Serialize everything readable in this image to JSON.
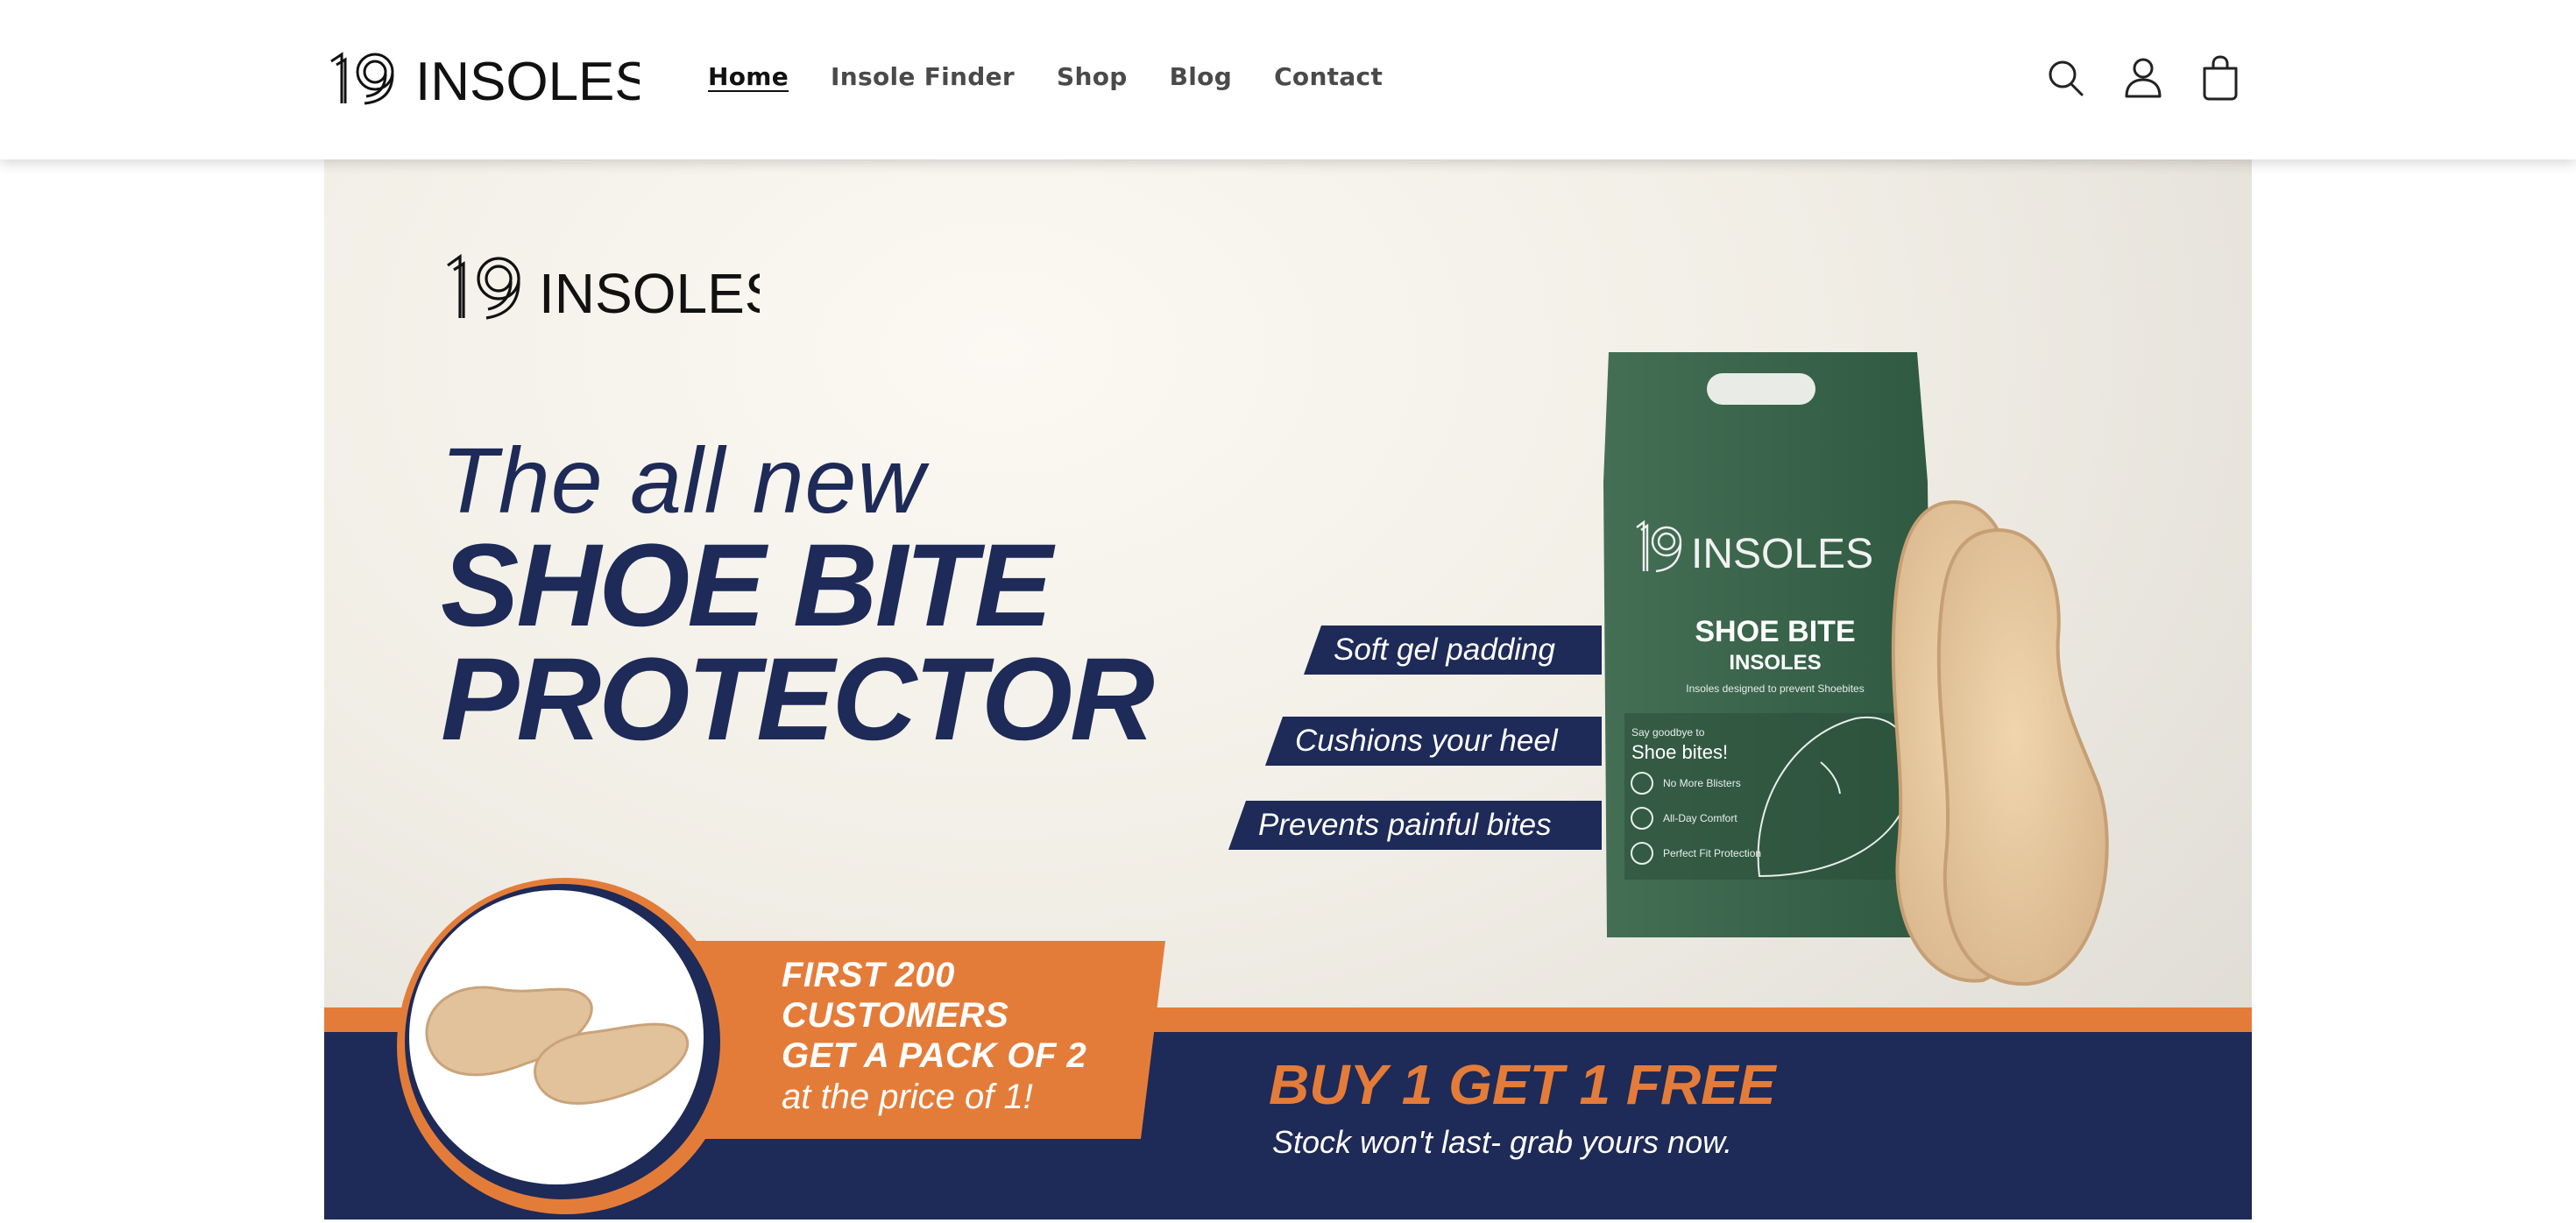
{
  "brand": {
    "logo_text": "19 INSOLES"
  },
  "nav": {
    "items": [
      {
        "label": "Home",
        "active": true
      },
      {
        "label": "Insole Finder",
        "active": false
      },
      {
        "label": "Shop",
        "active": false
      },
      {
        "label": "Blog",
        "active": false
      },
      {
        "label": "Contact",
        "active": false
      }
    ]
  },
  "header_icons": [
    "search-icon",
    "account-icon",
    "cart-icon"
  ],
  "banner": {
    "headline_line1": "The all new",
    "headline_line2": "SHOE BITE",
    "headline_line3": "PROTECTOR",
    "features": [
      "Soft gel padding",
      "Cushions your heel",
      "Prevents painful bites"
    ],
    "promo_line1": "FIRST 200",
    "promo_line2": "CUSTOMERS",
    "promo_line3": "GET A PACK OF 2",
    "promo_line4": "at the price of 1!",
    "offer": "BUY 1 GET 1 FREE",
    "stock_note": "Stock won't last- grab yours now.",
    "package": {
      "title": "SHOE BITE",
      "subtitle": "INSOLES",
      "tagline": "Insoles designed to prevent Shoebites",
      "callout_small": "Say goodbye to",
      "callout_big": "Shoe bites!",
      "benefits": [
        "No More Blisters",
        "All-Day Comfort",
        "Perfect Fit Protection"
      ]
    }
  },
  "colors": {
    "navy": "#1e2a57",
    "orange": "#e47c39",
    "pack_green": "#3d6a4f",
    "insole": "#e7c9a0"
  }
}
